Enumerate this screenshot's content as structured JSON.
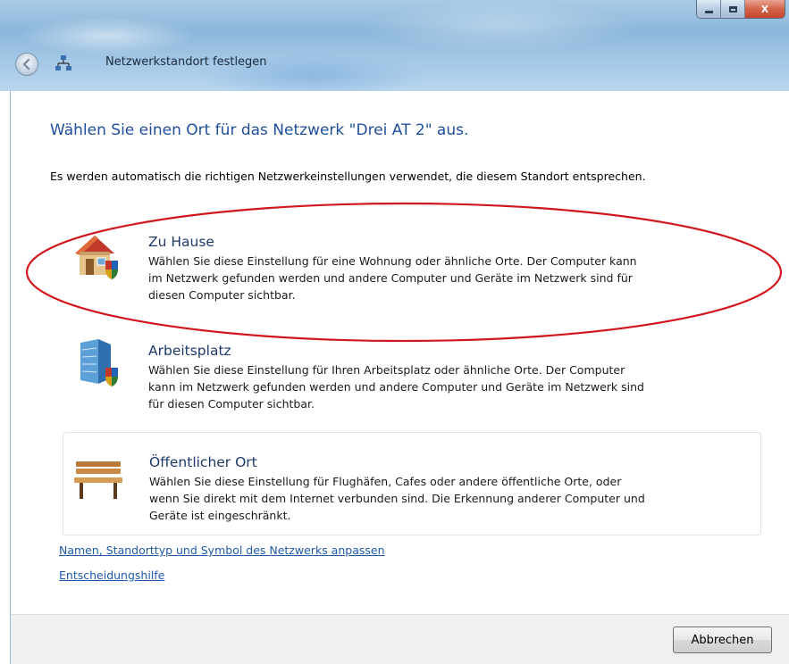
{
  "window": {
    "title": "Netzwerkstandort festlegen",
    "controls": {
      "minimize": "minimize-icon",
      "maximize": "maximize-icon",
      "close": "X"
    }
  },
  "main": {
    "heading": "Wählen Sie einen Ort für das Netzwerk \"Drei AT  2\" aus.",
    "description": "Es werden automatisch die richtigen Netzwerkeinstellungen verwendet, die diesem Standort entsprechen."
  },
  "options": [
    {
      "icon": "house-icon",
      "title": "Zu Hause",
      "lines": [
        "Wählen Sie diese Einstellung für eine Wohnung oder ähnliche Orte. Der Computer kann",
        "im Netzwerk gefunden werden und andere Computer und Geräte im Netzwerk sind für",
        "diesen Computer sichtbar."
      ]
    },
    {
      "icon": "office-building-icon",
      "title": "Arbeitsplatz",
      "lines": [
        "Wählen Sie diese Einstellung für Ihren Arbeitsplatz oder ähnliche Orte. Der Computer",
        "kann im Netzwerk gefunden werden und andere Computer und Geräte im Netzwerk sind",
        "für diesen Computer sichtbar."
      ]
    },
    {
      "icon": "park-bench-icon",
      "title": "Öffentlicher Ort",
      "lines": [
        "Wählen Sie diese Einstellung für Flughäfen, Cafes oder andere öffentliche Orte, oder",
        "wenn Sie direkt mit dem Internet verbunden sind. Die Erkennung anderer Computer und",
        "Geräte ist eingeschränkt."
      ]
    }
  ],
  "links": {
    "customize": "Namen, Standorttyp und Symbol des Netzwerks anpassen",
    "help": "Entscheidungshilfe"
  },
  "footer": {
    "cancel_label": "Abbrechen"
  },
  "colors": {
    "heading": "#1f4e9c",
    "link": "#1e5aa8",
    "annotation": "#d0171c"
  }
}
